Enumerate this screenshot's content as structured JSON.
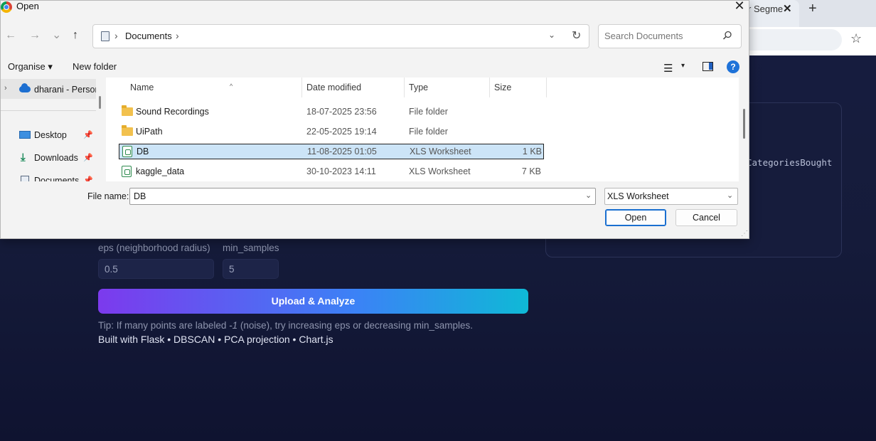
{
  "browser": {
    "tab_title": "r Segme",
    "close_glyph": "✕",
    "newtab_glyph": "+",
    "star_glyph": "☆"
  },
  "webpage": {
    "features_text": "CategoriesBought",
    "eps_label": "eps (neighborhood radius)",
    "eps_value": "0.5",
    "min_samples_label": "min_samples",
    "min_samples_value": "5",
    "analyze_button": "Upload & Analyze",
    "tip_prefix": "Tip: If many points are labeled ",
    "tip_noise_value": "-1",
    "tip_suffix": " (noise), try increasing eps or decreasing min_samples.",
    "footer": "Built with Flask • DBSCAN • PCA projection • Chart.js",
    "accent_gradient": [
      "#7c3aed",
      "#3b82f6",
      "#0fb9d6"
    ]
  },
  "dialog": {
    "title": "Open",
    "close_glyph": "✕",
    "nav": {
      "back": "←",
      "forward": "→",
      "recent": "⌄",
      "up": "↑"
    },
    "address": {
      "separator": "›",
      "current": "Documents",
      "dropdown": "⌄",
      "refresh": "↻"
    },
    "search_placeholder": "Search Documents",
    "toolbar": {
      "organise": "Organise ▾",
      "new_folder": "New folder",
      "view_glyph": "☰",
      "view_caret": "▾",
      "help": "?"
    },
    "nav_pane": {
      "onedrive": "dharani - Personal",
      "expander": "›",
      "items": [
        {
          "label": "Desktop",
          "pin": "📌"
        },
        {
          "label": "Downloads",
          "pin": "📌"
        },
        {
          "label": "Documents",
          "pin": "📌"
        }
      ]
    },
    "columns": [
      "Name",
      "Date modified",
      "Type",
      "Size"
    ],
    "sort_glyph": "^",
    "files": [
      {
        "name": "Sound Recordings",
        "date": "18-07-2025 23:56",
        "type": "File folder",
        "size": "",
        "kind": "folder",
        "selected": false
      },
      {
        "name": "UiPath",
        "date": "22-05-2025 19:14",
        "type": "File folder",
        "size": "",
        "kind": "folder",
        "selected": false
      },
      {
        "name": "DB",
        "date": "11-08-2025 01:05",
        "type": "XLS Worksheet",
        "size": "1 KB",
        "kind": "xls",
        "selected": true
      },
      {
        "name": "kaggle_data",
        "date": "30-10-2023 14:11",
        "type": "XLS Worksheet",
        "size": "7 KB",
        "kind": "xls",
        "selected": false
      }
    ],
    "file_name_label": "File name:",
    "file_name_value": "DB",
    "file_type_value": "XLS Worksheet",
    "dropdown_glyph": "⌄",
    "open_button": "Open",
    "cancel_button": "Cancel",
    "selection_color": "#cce4f7"
  }
}
